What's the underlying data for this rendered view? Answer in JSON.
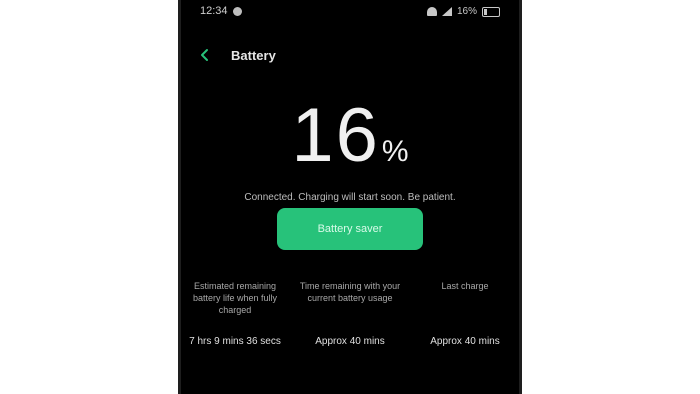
{
  "status_bar": {
    "time": "12:34",
    "battery_percent": "16%"
  },
  "app_bar": {
    "title": "Battery"
  },
  "battery": {
    "percent": "16",
    "percent_sign": "%",
    "status_text": "Connected. Charging will start soon. Be patient.",
    "button_label": "Battery saver"
  },
  "stats": [
    {
      "label": "Estimated remaining battery life when fully charged",
      "value": "7 hrs 9 mins 36 secs"
    },
    {
      "label": "Time remaining with your current battery usage",
      "value": "Approx 40 mins"
    },
    {
      "label": "Last charge",
      "value": "Approx 40 mins"
    }
  ],
  "colors": {
    "accent": "#27c27a",
    "background": "#000000"
  }
}
